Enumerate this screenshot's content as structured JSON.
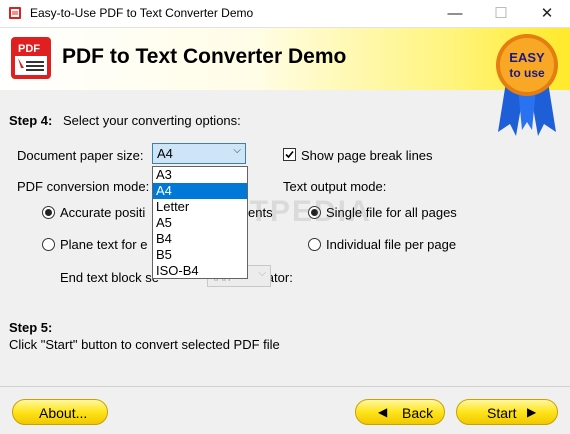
{
  "window": {
    "title": "Easy-to-Use PDF to Text Converter Demo",
    "minimize_glyph": "—",
    "maximize_glyph": "☐",
    "close_glyph": "✕"
  },
  "banner": {
    "title": "PDF to Text Converter Demo",
    "icon_text": "PDF",
    "badge_line1": "EASY",
    "badge_line2": "to use"
  },
  "step4": {
    "label": "Step 4:",
    "text": "Select your converting options:",
    "paper_size_label": "Document paper size:",
    "paper_size_value": "A4",
    "paper_sizes": [
      "A3",
      "A4",
      "Letter",
      "A5",
      "B4",
      "B5",
      "ISO-B4"
    ],
    "selected_index": 1,
    "page_break_label": "Show page break lines",
    "page_break_checked": true,
    "conversion_mode_label": "PDF conversion mode:",
    "accurate_label": "Accurate positi",
    "accurate_suffix": "ents",
    "plane_label": "Plane text for e",
    "separator_label": "End text block se",
    "separator_suffix": "parator:",
    "separator_value": "\\r\\n",
    "output_mode_label": "Text output mode:",
    "single_file_label": "Single file for all pages",
    "individual_file_label": "Individual file per page",
    "watermark": "SOFTPEDIA"
  },
  "step5": {
    "label": "Step 5:",
    "text": "Click \"Start\" button to convert selected PDF file"
  },
  "buttons": {
    "about": "About...",
    "back": "Back",
    "start": "Start"
  },
  "colors": {
    "accent": "#0078d7",
    "button_yellow": "#ffe41a",
    "badge_orange": "#f39c12",
    "ribbon_blue": "#1e5fd8",
    "pdf_red": "#e02020"
  }
}
